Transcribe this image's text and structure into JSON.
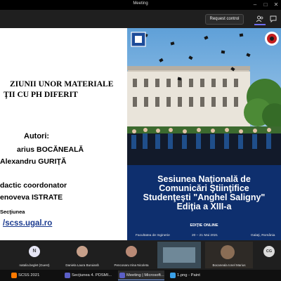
{
  "window": {
    "title": "Meeting"
  },
  "toolbar": {
    "request_control_label": "Request control"
  },
  "slide": {
    "heading_line1": "ZIUNII UNOR MATERIALE",
    "heading_line2": "ŢII CU PH DIFERIT",
    "authors_label": "Autori:",
    "author1": "arius BOCĂNEALĂ",
    "author2": "Alexandru GURIŢĂ",
    "coordinator_label": "dactic coordonator",
    "coordinator_name": "enoveva ISTRATE",
    "section_label": "Secţiunea",
    "url": "/scss.ugal.ro"
  },
  "poster": {
    "title_line1": "Sesiunea Naţională de",
    "title_line2": "Comunicări Ştiinţifice",
    "title_line3": "Studenţeşti \"Anghel Saligny\"",
    "title_line4": "Ediţia a XIII-a",
    "subtitle": "EDIŢIE ONLINE",
    "footer_left": "Facultatea de Inginerie",
    "footer_center": "20 – 21 Mai 2021",
    "footer_right": "Galaţi, România"
  },
  "participants": [
    {
      "name": "natalia.beglet (Guest)",
      "initials": "N",
      "avatar_color": "#e6e6f5"
    },
    {
      "name": "Daniela Laura Buruiană",
      "initials": "",
      "avatar_color": "#c7a08a"
    },
    {
      "name": "Pencosaru Irina Nicoleta",
      "initials": "",
      "avatar_color": "#b98a76"
    },
    {
      "name": "",
      "initials": "",
      "avatar_color": "#5c7a8a"
    },
    {
      "name": "Bocanealа Ionel Marius",
      "initials": "",
      "avatar_color": "#6a5a4a"
    },
    {
      "name": "",
      "initials": "CG",
      "avatar_color": "#dcdcdc"
    }
  ],
  "taskbar": {
    "items": [
      {
        "label": "SCSS 2021",
        "color": "#ff7a00"
      },
      {
        "label": "Secţiunea 4. PDSMI...",
        "color": "#5b5fc7"
      },
      {
        "label": "Meeting | Microsoft...",
        "color": "#5b5fc7"
      },
      {
        "label": "1.png - Paint",
        "color": "#3aa0e8"
      }
    ]
  }
}
